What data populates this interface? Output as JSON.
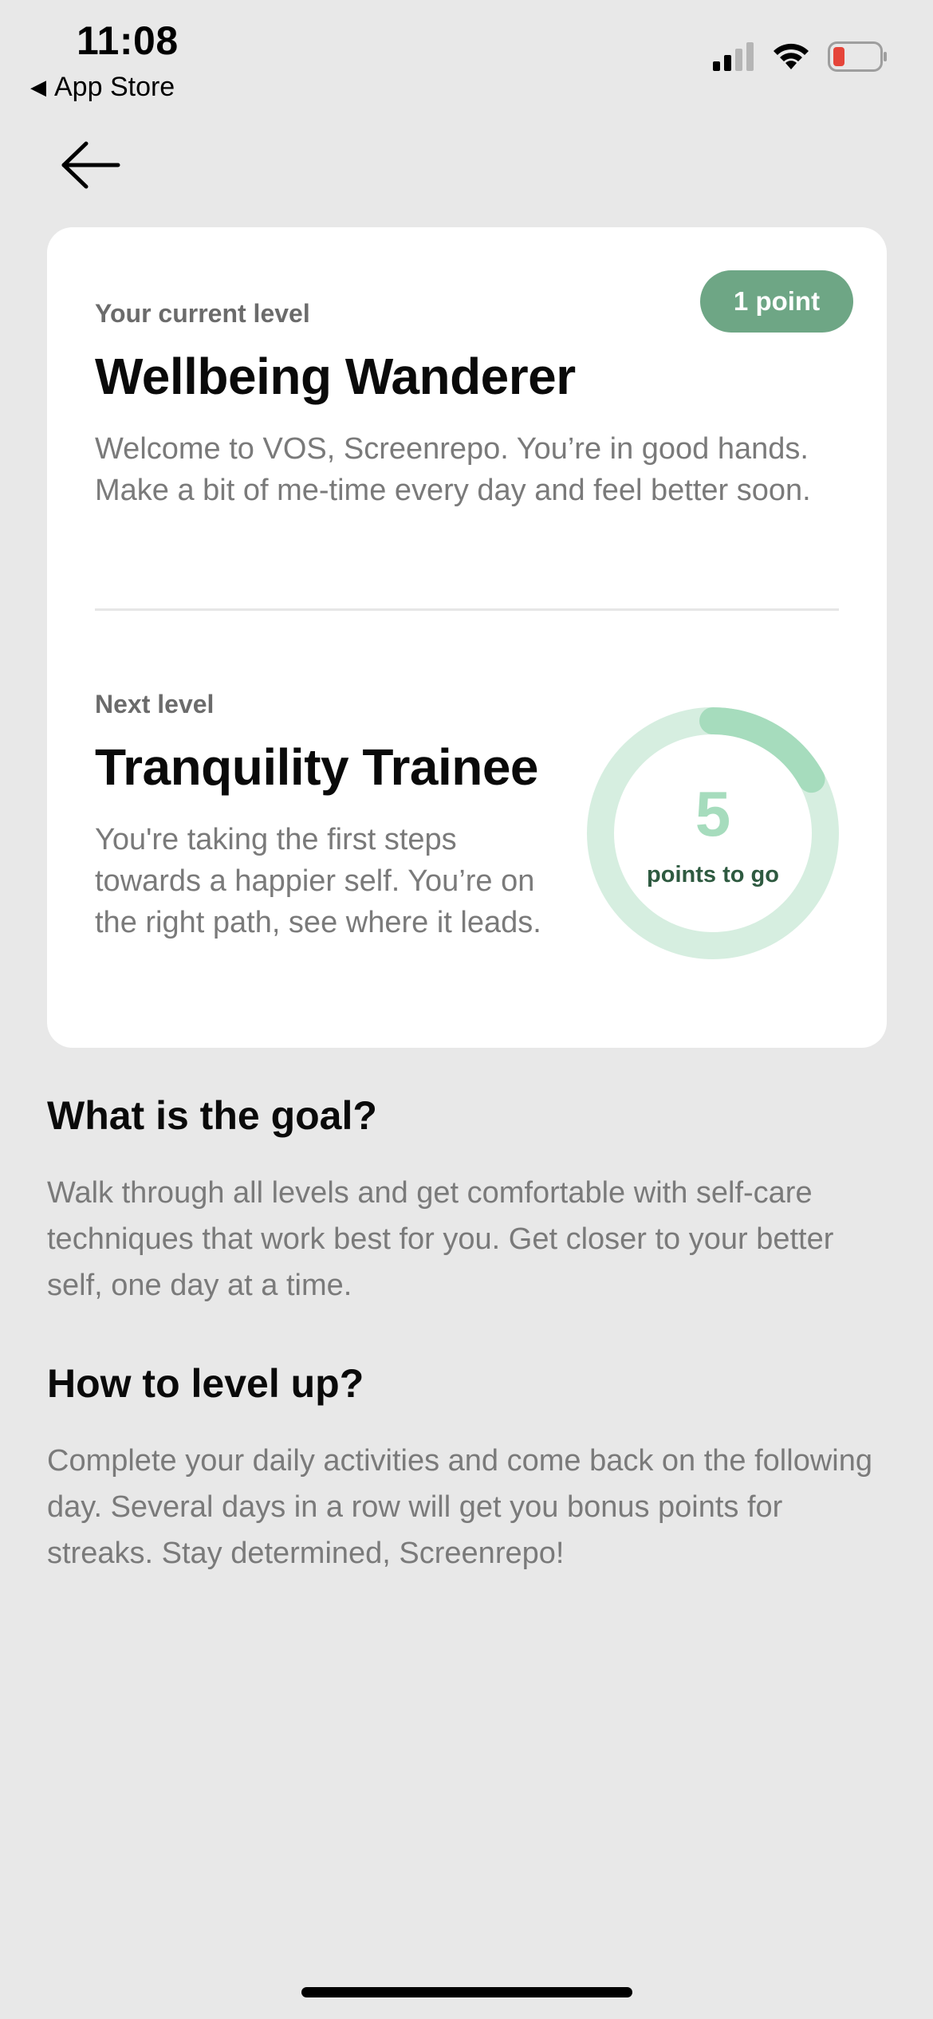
{
  "status_bar": {
    "time": "11:08",
    "back_label": "App Store",
    "back_glyph": "◀"
  },
  "nav": {
    "back_icon": "arrow-left-icon"
  },
  "card": {
    "points_badge": "1 point",
    "current": {
      "label": "Your current level",
      "title": "Wellbeing Wanderer",
      "description": "Welcome to VOS, Screenrepo. You’re in good hands. Make a bit of me-time every day and feel better soon."
    },
    "next": {
      "label": "Next level",
      "title": "Tranquility Trainee",
      "description": "You're taking the first steps towards a happier self. You’re on the right path, see where it leads."
    },
    "progress": {
      "points_to_go": "5",
      "caption": "points to go",
      "fraction": 0.17
    }
  },
  "sections": {
    "goal": {
      "title": "What is the goal?",
      "body": "Walk through all levels and get comfortable with self-care techniques that work best for you. Get closer to your better self, one day at a time."
    },
    "level_up": {
      "title": "How to level up?",
      "body": "Complete your daily activities and come back on the following day. Several days in a row will get you bonus points for streaks. Stay determined, Screenrepo!"
    }
  },
  "colors": {
    "background": "#e8e8e8",
    "card": "#ffffff",
    "pill": "#6ea685",
    "ring_track": "#d6eee0",
    "ring_progress": "#a6dcbd",
    "ring_caption": "#2e5a40"
  }
}
